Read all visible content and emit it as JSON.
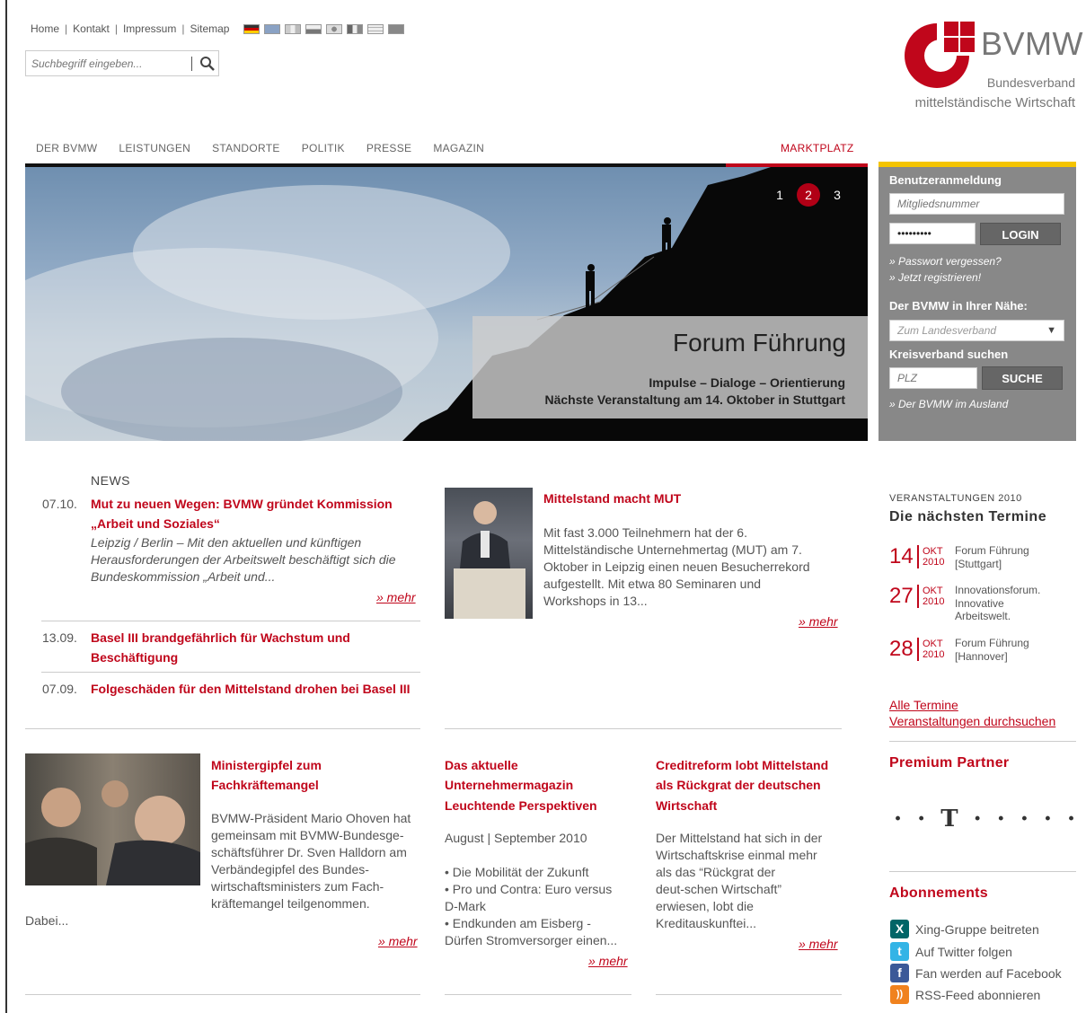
{
  "topnav": {
    "links": [
      "Home",
      "Kontakt",
      "Impressum",
      "Sitemap"
    ],
    "flags": [
      "de",
      "gb",
      "fr",
      "ru",
      "jp",
      "it",
      "il",
      "tr"
    ]
  },
  "search": {
    "placeholder": "Suchbegriff eingeben..."
  },
  "logo": {
    "name": "BVMW",
    "sub1": "Bundesverband",
    "sub2": "mittelständische Wirtschaft"
  },
  "mainnav": {
    "items": [
      "DER BVMW",
      "LEISTUNGEN",
      "STANDORTE",
      "POLITIK",
      "PRESSE",
      "MAGAZIN"
    ],
    "marktplatz": "MARKTPLATZ"
  },
  "hero": {
    "title": "Forum Führung",
    "sub1": "Impulse – Dialoge – Orientierung",
    "sub2": "Nächste Veranstaltung am 14. Oktober in Stuttgart",
    "pages": [
      "1",
      "2",
      "3"
    ],
    "active_page": "2"
  },
  "login": {
    "heading": "Benutzeranmeldung",
    "member_placeholder": "Mitgliedsnummer",
    "password_value": "•••••••••",
    "login_label": "LOGIN",
    "forgot": "» Passwort vergessen?",
    "register": "» Jetzt registrieren!",
    "near_heading": "Der BVMW in Ihrer Nähe:",
    "landesverband": "Zum Landesverband",
    "kreis_heading": "Kreisverband suchen",
    "plz_placeholder": "PLZ",
    "search_label": "SUCHE",
    "ausland": "» Der BVMW im Ausland"
  },
  "news": {
    "heading": "NEWS",
    "items": [
      {
        "date": "07.10.",
        "title1": "Mut zu neuen Wegen: BVMW gründet Kommission",
        "title2": "„Arbeit und Soziales“",
        "text1": "Leipzig / Berlin – Mit den aktuellen und künftigen",
        "text2": "Herausforderungen der Arbeitswelt beschäftigt sich die",
        "text3": "Bundeskommission „Arbeit und...",
        "more": "» mehr"
      },
      {
        "date": "13.09.",
        "title1": "Basel III brandgefährlich für Wachstum und",
        "title2": "Beschäftigung"
      },
      {
        "date": "07.09.",
        "title1": "Folgeschäden für den Mittelstand drohen bei Basel III"
      }
    ]
  },
  "mut": {
    "title": "Mittelstand macht MUT",
    "lines": [
      "Mit fast 3.000 Teilnehmern hat der 6.",
      "Mittelständische Unternehmertag (MUT) am 7.",
      "Oktober in Leipzig einen neuen Besucherrekord",
      "aufgestellt. Mit etwa 80 Seminaren und",
      "Workshops in 13..."
    ],
    "more": "» mehr"
  },
  "minister": {
    "title1": "Ministergipfel zum",
    "title2": "Fachkräftemangel",
    "lines": [
      "BVMW-Präsident Mario Ohoven hat",
      "gemeinsam mit BVMW-Bundesge-",
      "schäftsführer Dr. Sven Halldorn am",
      "Verbändegipfel des Bundes-",
      "wirtschaftsministers zum Fach-",
      "kräftemangel teilgenommen."
    ],
    "dabei": "Dabei...",
    "more": "» mehr"
  },
  "magazin": {
    "title1": "Das aktuelle",
    "title2": "Unternehmermagazin",
    "title3": "Leuchtende Perspektiven",
    "issue": "August | September 2010",
    "lines": [
      "• Die Mobilität der Zukunft",
      "• Pro und Contra: Euro versus",
      "D-Mark",
      "• Endkunden am Eisberg -",
      "Dürfen Stromversorger einen..."
    ],
    "more": "» mehr"
  },
  "creditreform": {
    "title1": "Creditreform lobt Mittelstand",
    "title2": "als Rückgrat der deutschen",
    "title3": "Wirtschaft",
    "lines": [
      "Der Mittelstand hat sich in der",
      "Wirtschaftskrise einmal mehr",
      "als das “Rückgrat der",
      "deut-schen Wirtschaft”",
      "erwiesen, lobt die",
      "Kreditauskunftei..."
    ],
    "more": "» mehr"
  },
  "events": {
    "small": "VERANSTALTUNGEN 2010",
    "heading": "Die nächsten Termine",
    "items": [
      {
        "day": "14",
        "month": "OKT",
        "year": "2010",
        "l1": "Forum Führung",
        "l2": "[Stuttgart]",
        "l3": ""
      },
      {
        "day": "27",
        "month": "OKT",
        "year": "2010",
        "l1": "Innovationsforum.",
        "l2": "Innovative",
        "l3": "Arbeitswelt."
      },
      {
        "day": "28",
        "month": "OKT",
        "year": "2010",
        "l1": "Forum Führung",
        "l2": "[Hannover]",
        "l3": ""
      }
    ],
    "all": "Alle Termine",
    "search": "Veranstaltungen durchsuchen"
  },
  "premium": {
    "title": "Premium Partner",
    "logo": "· · T · · · · ·"
  },
  "abos": {
    "title": "Abonnements",
    "items": [
      {
        "label": "Xing-Gruppe beitreten",
        "icon": "xing-icon",
        "color": "#006567",
        "glyph": "X"
      },
      {
        "label": "Auf Twitter folgen",
        "icon": "twitter-icon",
        "color": "#33b4e6",
        "glyph": "t"
      },
      {
        "label": "Fan werden auf Facebook",
        "icon": "facebook-icon",
        "color": "#3b5998",
        "glyph": "f"
      },
      {
        "label": "RSS-Feed abonnieren",
        "icon": "rss-icon",
        "color": "#f0821e",
        "glyph": "))"
      }
    ]
  },
  "colors": {
    "accent": "#c0061b",
    "login_bg": "#888888",
    "login_top": "#f5c400"
  }
}
